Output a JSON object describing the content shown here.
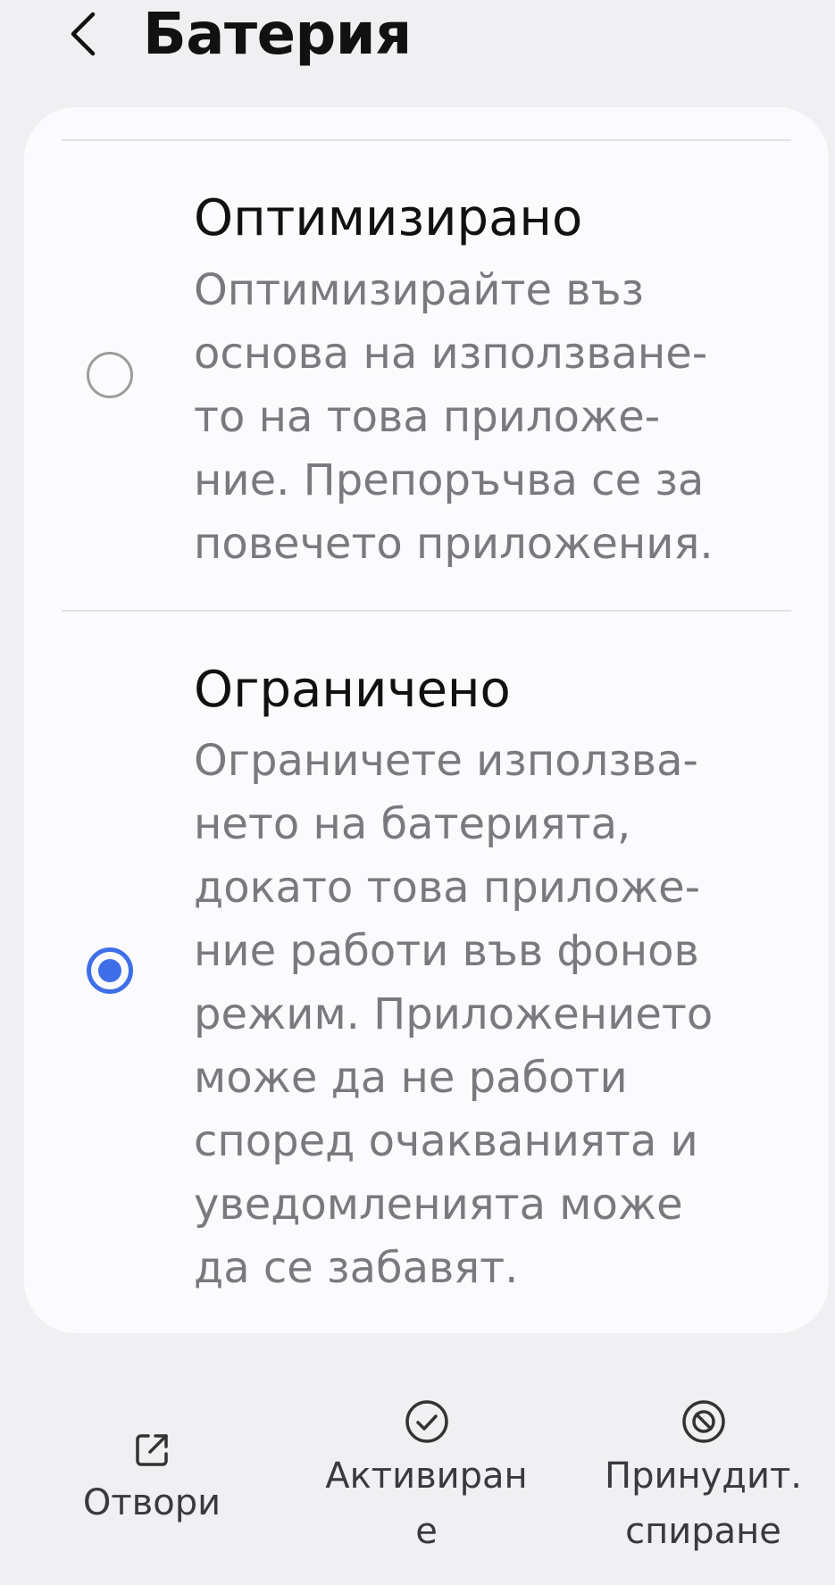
{
  "header": {
    "title": "Батерия",
    "back_icon": "chevron-left-icon"
  },
  "options": [
    {
      "title": "Оптимизирано",
      "description_lines": [
        "Оптимизирайте въз",
        "основа на използване-",
        "то на това приложе-",
        "ние. Препоръчва се за",
        "повечето приложения."
      ],
      "selected": false
    },
    {
      "title": "Ограничено",
      "description_lines": [
        "Ограничете използва-",
        "нето на батерията,",
        "докато това приложе-",
        "ние работи във фонов",
        "режим. Приложението",
        "може да не работи",
        "според очакванията и",
        "уведомленията може",
        "да се забавят."
      ],
      "selected": true
    }
  ],
  "actions": [
    {
      "label_lines": [
        "Отвори"
      ],
      "icon": "open-external-icon"
    },
    {
      "label_lines": [
        "Активиран",
        "е"
      ],
      "icon": "check-circle-icon"
    },
    {
      "label_lines": [
        "Принудит.",
        "спиране"
      ],
      "icon": "force-stop-icon"
    }
  ],
  "colors": {
    "accent": "#3e6fe8",
    "background": "#f0f0f2",
    "card": "#fbfbfd",
    "title_text": "#111111",
    "secondary_text": "#7a7a7e"
  }
}
